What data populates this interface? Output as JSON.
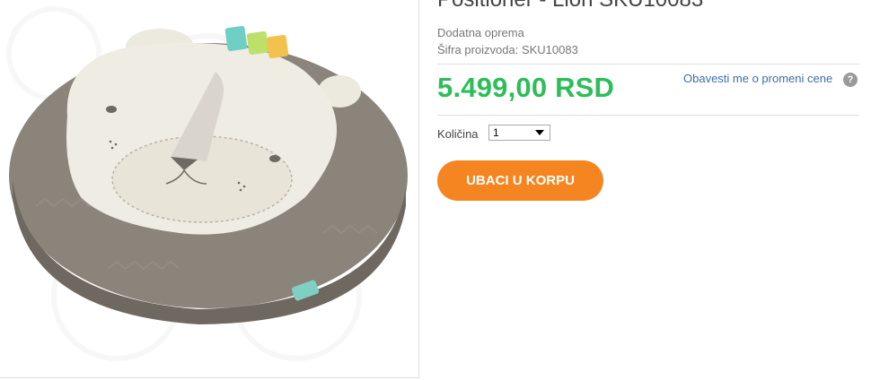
{
  "product": {
    "category": "Dodatna oprema",
    "sku_label": "Šifra proizvoda:",
    "sku_value": "SKU10083",
    "price": "5.499,00 RSD",
    "notify_link": "Obavesti me o promeni cene",
    "help_icon": "question-circle-icon",
    "quantity_label": "Količina",
    "quantity_value": "1",
    "add_to_cart": "UBACI U KORPU",
    "image_alt": "lion-lounger-pillow-image"
  },
  "colors": {
    "price_green": "#2ebd59",
    "button_orange": "#f58520",
    "link_blue": "#3a6fa8"
  }
}
